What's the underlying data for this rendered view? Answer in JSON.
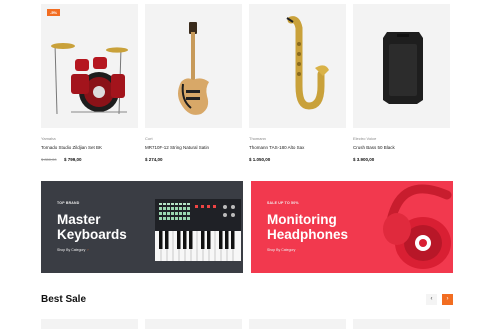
{
  "products": [
    {
      "badge": "-5%",
      "brand": "Yamaha",
      "name": "Tornado Studio Zildjian Set BK",
      "old_price": "$ 850,00",
      "price": "$ 799,00",
      "icon": "drum-kit-icon"
    },
    {
      "badge": "",
      "brand": "Cort",
      "name": "MR710F-12 String Natural Satin",
      "old_price": "",
      "price": "$ 274,00",
      "icon": "electric-guitar-icon"
    },
    {
      "badge": "",
      "brand": "Thomann",
      "name": "Thomann TAS-180 Alto Sax",
      "old_price": "",
      "price": "$ 1.050,00",
      "icon": "saxophone-icon"
    },
    {
      "badge": "",
      "brand": "Electro Voice",
      "name": "Crush Bass 50 Black",
      "old_price": "",
      "price": "$ 3.900,00",
      "icon": "speaker-icon"
    }
  ],
  "banners": [
    {
      "tag": "TOP BRAND",
      "title": "Master Keyboards",
      "link": "Shop By Category",
      "arrow": "›",
      "color": "#3a3d44",
      "icon": "keyboard-icon"
    },
    {
      "tag": "SALE UP TO 50%",
      "title": "Monitoring Headphones",
      "link": "Shop By Category",
      "arrow": "›",
      "color": "#f2394e",
      "icon": "headphones-icon"
    }
  ],
  "best_sale": {
    "title": "Best Sale",
    "prev": "‹",
    "next": "›"
  },
  "colors": {
    "accent": "#f26d21",
    "dark_banner": "#3a3d44",
    "red_banner": "#f2394e"
  }
}
